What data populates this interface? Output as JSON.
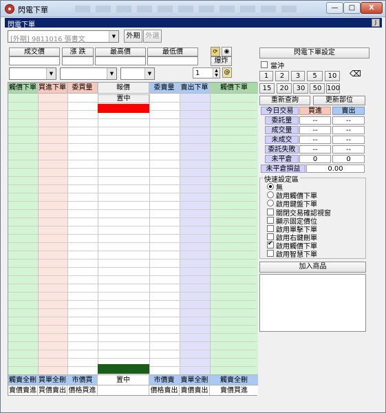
{
  "window": {
    "title": "閃電下單",
    "header_title": "閃電下單",
    "header_button": "J",
    "controls": {
      "minimize": "—",
      "maximize": "□",
      "close": "X"
    }
  },
  "account": {
    "value": "[外期]  9811016 張書文",
    "tab_foreign": "外期",
    "tab_foreign_options": "外選"
  },
  "quote_headers": [
    "成交價",
    "漲 跌",
    "最高價",
    "最低價"
  ],
  "order_row": {
    "qty_value": "1",
    "burst_label": "爆炸",
    "at_label": "@"
  },
  "ladder": {
    "headers": [
      "觸價下單",
      "買進下單",
      "委買量",
      "報價",
      "委賣量",
      "賣出下單",
      "觸價下單"
    ],
    "center_label": "置中",
    "bottom_center_label": "置中",
    "footer_row1": [
      "觸賣全刪",
      "買單全刪",
      "市價買",
      "置中",
      "市價賣",
      "賣單全刪",
      "觸賣全刪"
    ],
    "footer_row2": [
      "賣價賣進",
      "買價賣出",
      "價格買進",
      "",
      "價格賣出",
      "賣價賣出",
      "賣價買進"
    ]
  },
  "right": {
    "settings_button": "閃電下單設定",
    "offset_label": "當沖",
    "qty_buttons_row1": [
      "1",
      "2",
      "3",
      "5",
      "10"
    ],
    "qty_buttons_row2": [
      "15",
      "20",
      "30",
      "50",
      "100"
    ],
    "requery_button": "重新查詢",
    "update_position_button": "更新部位",
    "stats": {
      "today_label": "今日交易",
      "buy_label": "買進",
      "sell_label": "賣出",
      "rows": [
        {
          "label": "委託量",
          "buy": "--",
          "sell": "--"
        },
        {
          "label": "成交量",
          "buy": "--",
          "sell": "--"
        },
        {
          "label": "未成交",
          "buy": "--",
          "sell": "--"
        },
        {
          "label": "委託失敗",
          "buy": "--",
          "sell": "--"
        },
        {
          "label": "未平倉",
          "buy": "0",
          "sell": "0"
        }
      ],
      "pnl_label": "未平倉損益",
      "pnl_value": "0.00"
    },
    "quick_settings": {
      "title": "快速設定區",
      "radios": [
        {
          "label": "無",
          "checked": true
        },
        {
          "label": "啟用觸價下單",
          "checked": false
        },
        {
          "label": "啟用鍵盤下單",
          "checked": false
        }
      ],
      "checks": [
        {
          "label": "關閉交易確認視窗",
          "checked": false
        },
        {
          "label": "顯示固定價位",
          "checked": false
        },
        {
          "label": "啟用單擊下單",
          "checked": false
        },
        {
          "label": "啟用右鍵刪單",
          "checked": false
        },
        {
          "label": "啟用觸價下單",
          "checked": true
        },
        {
          "label": "啟用智慧下單",
          "checked": false
        }
      ]
    },
    "add_product_button": "加入商品"
  },
  "colors": {
    "green_col": "#d4f5d4",
    "pink_col": "#fde5df",
    "blue_col": "#e0e0fb",
    "center_red": "#ff0000",
    "center_dark_green": "#1a5c1a",
    "header_blue": "#a9c8f2",
    "footer_blue": "#a9c8f2"
  }
}
